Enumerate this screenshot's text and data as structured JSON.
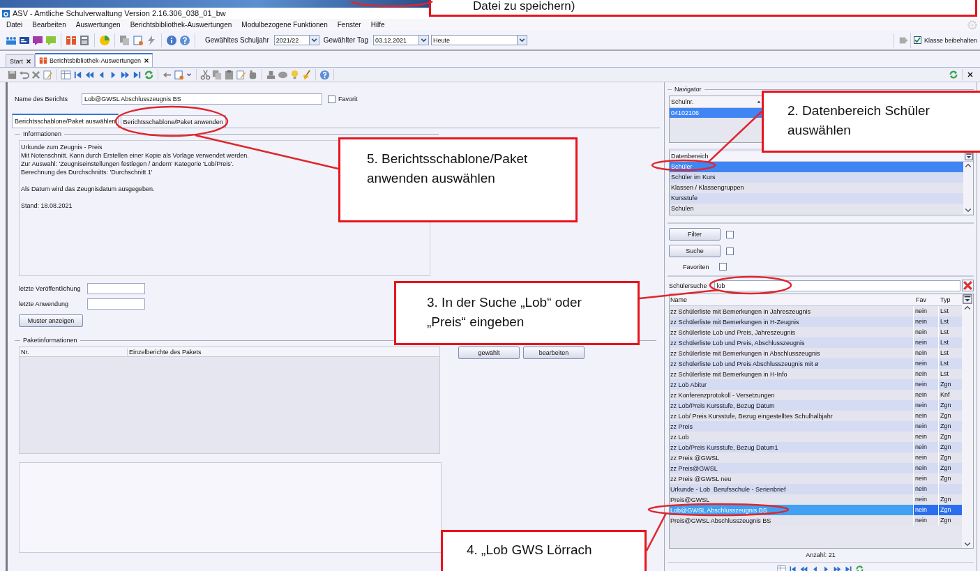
{
  "window": {
    "title": "ASV - Amtliche Schulverwaltung Version 2.16.306_038_01_bw"
  },
  "menu": [
    "Datei",
    "Bearbeiten",
    "Auswertungen",
    "Berichtsbibliothek-Auswertungen",
    "Modulbezogene Funktionen",
    "Fenster",
    "Hilfe"
  ],
  "toolbar": {
    "year_label": "Gewähltes Schuljahr",
    "year": "2021/22",
    "day_label": "Gewählter Tag",
    "day": "03.12.2021",
    "view": "Heute",
    "keep_class": {
      "label": "Klasse beibehalten",
      "checked": true
    }
  },
  "tabs": [
    {
      "label": "Start",
      "selected": false
    },
    {
      "label": "Berichtsbibliothek-Auswertungen",
      "selected": true
    }
  ],
  "report": {
    "name_label": "Name des Berichts",
    "name": "Lob@GWSL Abschlusszeugnis BS",
    "favorite": {
      "label": "Favorit",
      "checked": false
    }
  },
  "subtabs": [
    {
      "label": "Berichtsschablone/Paket auswählen",
      "selected": true
    },
    {
      "label": "Berichtsschablone/Paket anwenden",
      "selected": false
    }
  ],
  "information": {
    "title": "Informationen",
    "paragraphs": [
      [
        "Urkunde zum Zeugnis - Preis",
        "Mit Notenschnitt. Kann durch Erstellen einer Kopie als Vorlage verwendet werden.",
        "Zur Auswahl: 'Zeugniseinstellungen festlegen / ändern' Kategorie 'Lob/Preis'.",
        "Berechnung des Durchschnitts: 'Durchschnitt 1'"
      ],
      [
        "Als Datum wird das Zeugnisdatum ausgegeben."
      ],
      [
        "Stand: 18.08.2021"
      ]
    ]
  },
  "fields": [
    {
      "label": "letzte Veröffentlichung"
    },
    {
      "label": "letzte Anwendung"
    }
  ],
  "sample_button": "Muster anzeigen",
  "package": {
    "title": "Paketinformationen",
    "columns": [
      "Nr.",
      "Einzelberichte des Pakets"
    ],
    "buttons": [
      "gewählt",
      "bearbeiten"
    ]
  },
  "navigator": {
    "title": "Navigator",
    "school": {
      "column": "Schulnr.",
      "rows": [
        {
          "value": "04102106",
          "selected": true
        }
      ]
    },
    "data_area": {
      "column": "Datenbereich",
      "items": [
        {
          "label": "Schüler",
          "selected": true
        },
        {
          "label": "Schüler im Kurs",
          "selected": false
        },
        {
          "label": "Klassen / Klassengruppen",
          "selected": false
        },
        {
          "label": "Kursstufe",
          "selected": false
        },
        {
          "label": "Schulen",
          "selected": false
        }
      ]
    },
    "filter": {
      "label": "Filter",
      "checked": false
    },
    "search": {
      "label": "Suche",
      "checked": false
    },
    "favorites": {
      "label": "Favoriten",
      "checked": false
    },
    "student_search": {
      "label": "Schülersuche",
      "value": "lob"
    },
    "reports": {
      "columns": [
        "Name",
        "Fav",
        "Typ"
      ],
      "rows": [
        {
          "name": "zz Schülerliste mit Bemerkungen in Jahreszeugnis",
          "fav": "nein",
          "type": "Lst",
          "selected": false
        },
        {
          "name": "zz Schülerliste mit Bemerkungen in H-Zeugnis",
          "fav": "nein",
          "type": "Lst",
          "selected": false
        },
        {
          "name": "zz Schülerliste Lob und Preis, Jahreszeugnis",
          "fav": "nein",
          "type": "Lst",
          "selected": false
        },
        {
          "name": "zz Schülerliste Lob und Preis, Abschlusszeugnis",
          "fav": "nein",
          "type": "Lst",
          "selected": false
        },
        {
          "name": "zz Schülerliste mit Bemerkungen in Abschlusszeugnis",
          "fav": "nein",
          "type": "Lst",
          "selected": false
        },
        {
          "name": "zz Schülerliste Lob und Preis Abschlusszeugnis mit ø",
          "fav": "nein",
          "type": "Lst",
          "selected": false
        },
        {
          "name": "zz Schülerliste mit Bemerkungen in H-Info",
          "fav": "nein",
          "type": "Lst",
          "selected": false
        },
        {
          "name": "zz Lob Abitur",
          "fav": "nein",
          "type": "Zgn",
          "selected": false
        },
        {
          "name": "zz Konferenzprotokoll - Versetzungen",
          "fav": "nein",
          "type": "Knf",
          "selected": false
        },
        {
          "name": "zz Lob/Preis Kursstufe, Bezug Datum",
          "fav": "nein",
          "type": "Zgn",
          "selected": false
        },
        {
          "name": "zz Lob/ Preis Kursstufe, Bezug eingestelltes Schulhalbjahr",
          "fav": "nein",
          "type": "Zgn",
          "selected": false
        },
        {
          "name": "zz Preis",
          "fav": "nein",
          "type": "Zgn",
          "selected": false
        },
        {
          "name": "zz Lob",
          "fav": "nein",
          "type": "Zgn",
          "selected": false
        },
        {
          "name": "zz Lob/Preis Kursstufe, Bezug Datum1",
          "fav": "nein",
          "type": "Zgn",
          "selected": false
        },
        {
          "name": "zz Preis @GWSL",
          "fav": "nein",
          "type": "Zgn",
          "selected": false
        },
        {
          "name": "zz Preis@GWSL",
          "fav": "nein",
          "type": "Zgn",
          "selected": false
        },
        {
          "name": "zz Preis @GWSL neu",
          "fav": "nein",
          "type": "Zgn",
          "selected": false
        },
        {
          "name": "Urkunde - Lob  Berufsschule - Serienbrief",
          "fav": "nein",
          "selected": false
        },
        {
          "name": "Preis@GWSL",
          "fav": "nein",
          "type": "Zgn",
          "selected": false
        },
        {
          "name": "Lob@GWSL Abschlusszeugnis BS",
          "fav": "nein",
          "type": "Zgn",
          "selected": true
        },
        {
          "name": "Preis@GWSL Abschlusszeugnis BS",
          "fav": "nein",
          "type": "Zgn",
          "selected": false
        }
      ]
    },
    "count": "Anzahl: 21"
  },
  "annotations": [
    {
      "lines": [
        "Datei zu speichern)"
      ]
    },
    {
      "lines": [
        "5. Berichtsschablone/Paket",
        "anwenden auswählen"
      ]
    },
    {
      "lines": [
        "2. Datenbereich Schüler",
        "auswählen"
      ]
    },
    {
      "lines": [
        "3. In der Suche „Lob“ oder",
        "„Preis“ eingeben"
      ]
    },
    {
      "lines": [
        "4. „Lob GWS Lörrach"
      ]
    }
  ]
}
